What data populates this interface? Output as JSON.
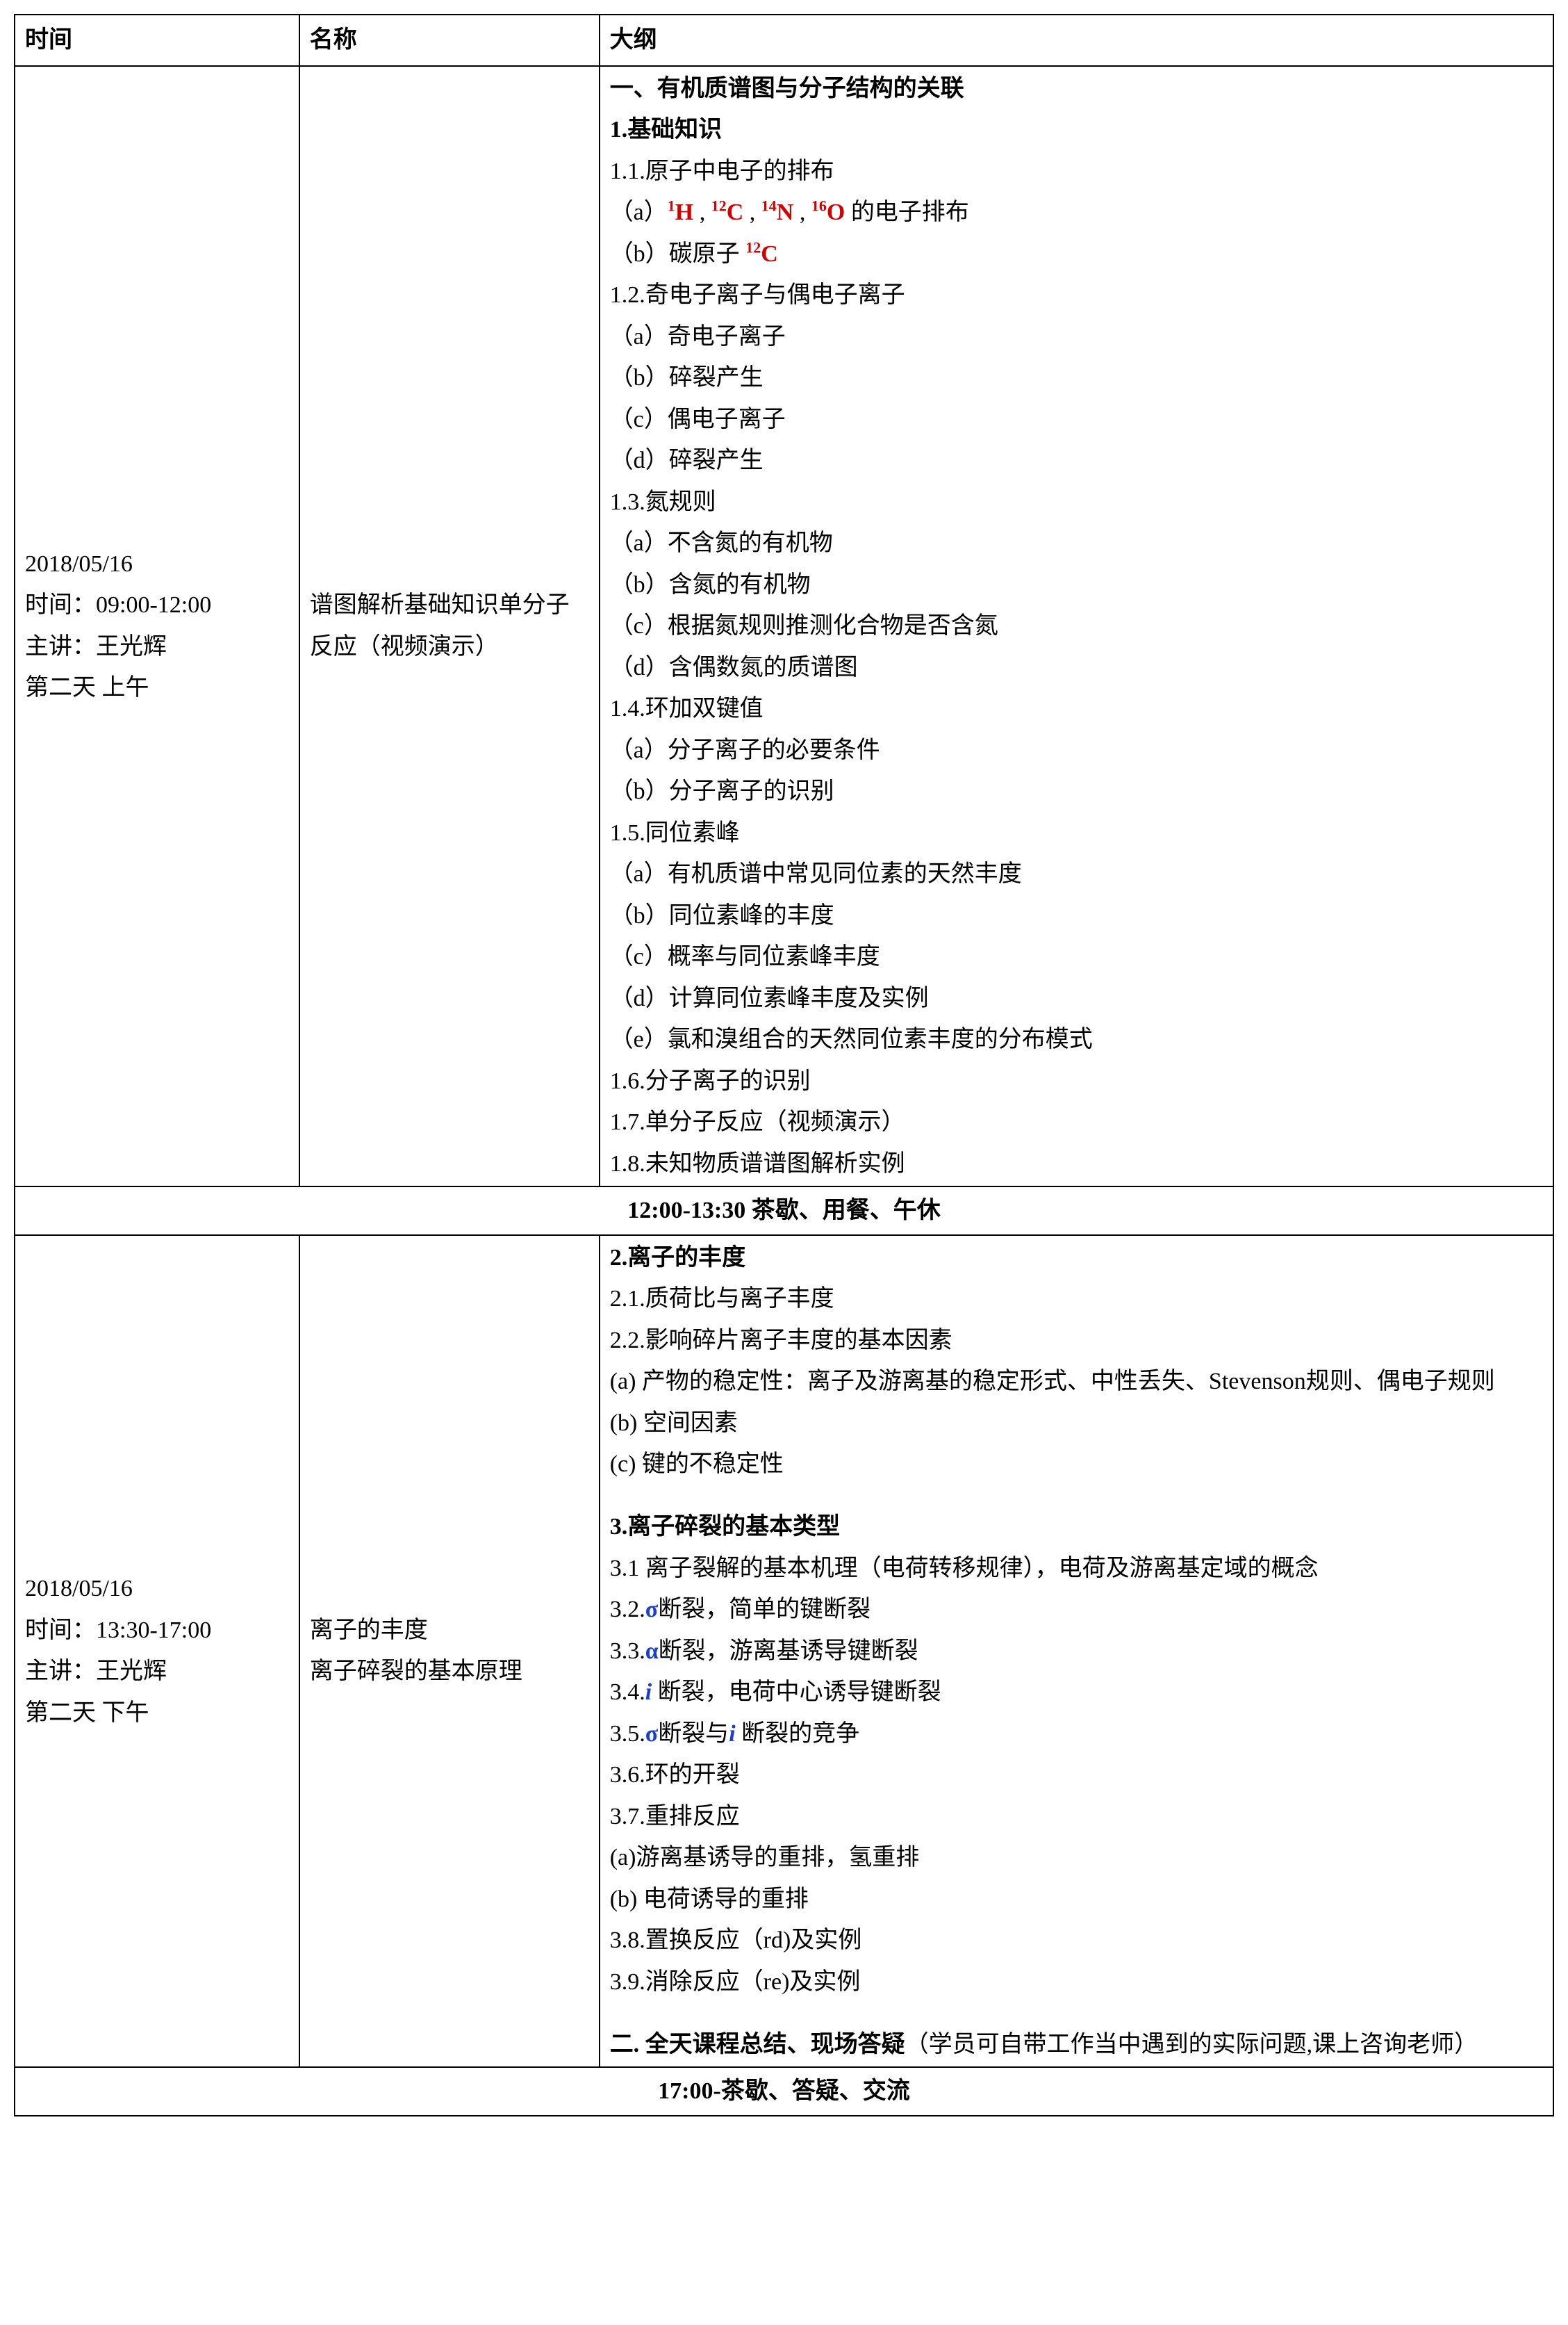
{
  "headers": {
    "time": "时间",
    "name": "名称",
    "outline": "大纲"
  },
  "row1": {
    "time": {
      "date": "2018/05/16",
      "slot": "时间：09:00-12:00",
      "speaker": "主讲：王光辉",
      "day": "第二天 上午"
    },
    "name": "谱图解析基础知识单分子反应（视频演示）",
    "outline": {
      "h1": "一、有机质谱图与分子结构的关联",
      "s1": "1.基础知识",
      "l11": "1.1.原子中电子的排布",
      "l11a_pre": "（a）",
      "iso_h": "H",
      "iso_c": "C",
      "iso_n": "N",
      "iso_o": "O",
      "l11a_post": " 的电子排布",
      "l11b_pre": "（b）碳原子 ",
      "l12": "1.2.奇电子离子与偶电子离子",
      "l12a": "（a）奇电子离子",
      "l12b": "（b）碎裂产生",
      "l12c": "（c）偶电子离子",
      "l12d": "（d）碎裂产生",
      "l13": "1.3.氮规则",
      "l13a": "（a）不含氮的有机物",
      "l13b": "（b）含氮的有机物",
      "l13c": "（c）根据氮规则推测化合物是否含氮",
      "l13d": "（d）含偶数氮的质谱图",
      "l14": "1.4.环加双键值",
      "l14a": "（a）分子离子的必要条件",
      "l14b": "（b）分子离子的识别",
      "l15": "1.5.同位素峰",
      "l15a": "（a）有机质谱中常见同位素的天然丰度",
      "l15b": "（b）同位素峰的丰度",
      "l15c": "（c）概率与同位素峰丰度",
      "l15d": "（d）计算同位素峰丰度及实例",
      "l15e": "（e）氯和溴组合的天然同位素丰度的分布模式",
      "l16": "1.6.分子离子的识别",
      "l17": "1.7.单分子反应（视频演示）",
      "l18": "1.8.未知物质谱谱图解析实例"
    }
  },
  "break1": "12:00-13:30 茶歇、用餐、午休",
  "row2": {
    "time": {
      "date": "2018/05/16",
      "slot": "时间：13:30-17:00",
      "speaker": "主讲：王光辉",
      "day": "第二天 下午"
    },
    "name": {
      "l1": "离子的丰度",
      "l2": "离子碎裂的基本原理"
    },
    "outline": {
      "s2": "2.离子的丰度",
      "l21": "2.1.质荷比与离子丰度",
      "l22": "2.2.影响碎片离子丰度的基本因素",
      "l22a": "(a) 产物的稳定性：离子及游离基的稳定形式、中性丢失、Stevenson规则、偶电子规则",
      "l22b": "(b) 空间因素",
      "l22c": "(c) 键的不稳定性",
      "s3": "3.离子碎裂的基本类型",
      "l31": "3.1 离子裂解的基本机理（电荷转移规律），电荷及游离基定域的概念",
      "l32_pre": "3.2.",
      "sigma": "σ",
      "l32_post": "断裂，简单的键断裂",
      "l33_pre": "3.3.",
      "alpha": "α",
      "l33_post": "断裂，游离基诱导键断裂",
      "l34_pre": "3.4.",
      "i_sym": "i",
      "l34_post": "断裂，电荷中心诱导键断裂",
      "l35_pre": "3.5.",
      "l35_mid": "断裂与",
      "l35_post": " 断裂的竞争",
      "l36": "3.6.环的开裂",
      "l37": "3.7.重排反应",
      "l37a": "(a)游离基诱导的重排，氢重排",
      "l37b": "(b) 电荷诱导的重排",
      "l38": "3.8.置换反应（rd)及实例",
      "l39": "3.9.消除反应（re)及实例",
      "h2_a": "二. 全天课程总结、现场答疑",
      "h2_b": "（学员可自带工作当中遇到的实际问题,课上咨询老师）"
    }
  },
  "break2": "17:00-茶歇、答疑、交流"
}
